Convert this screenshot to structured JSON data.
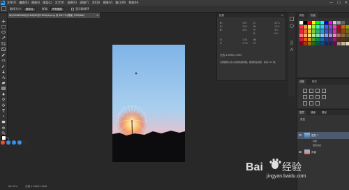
{
  "menubar": {
    "items": [
      "文件(F)",
      "编辑(E)",
      "图像(I)",
      "图层(L)",
      "文字(Y)",
      "选择(S)",
      "滤镜(T)",
      "3D(D)",
      "视图(V)",
      "窗口(W)",
      "帮助(H)"
    ],
    "window_controls": [
      "—",
      "□",
      "✕"
    ]
  },
  "options": {
    "sample_label": "取样大小:",
    "sample_value": "取样点",
    "sample_all_label": "样本:",
    "sample_all_value": "所有图层",
    "show_ring_label": "显示取样环"
  },
  "document": {
    "tab_title": "WJ-ADSKGN8(CJ1D8)0E@F1K6LJA.png @ 66.7%(背景, RGB/8#)",
    "close": "×"
  },
  "info": {
    "title": "信息",
    "r_label": "R:",
    "g_label": "G:",
    "b_label": "B:",
    "c_label": "C:",
    "m_label": "M:",
    "y_label": "Y:",
    "k_label": "K:",
    "x_label": "X:",
    "y2_label": "Y:",
    "w_label": "W:",
    "h_label": "H:",
    "r_val": "159",
    "g_val": "196",
    "b_val": "230",
    "c_val": "42%",
    "m_val": "14%",
    "y_val": "4%",
    "k_val": "0%",
    "x_val": "3.81",
    "y2_val": "4.50",
    "doc_line": "文档:1.69M/1.69M",
    "hint_line": "点按图像以置入新颜色取样器。要用附加选项，使用 Ctrl 键。"
  },
  "swatches": {
    "tabs": [
      "颜色",
      "色板"
    ],
    "colors": [
      "#ffffff",
      "#000000",
      "#ff0000",
      "#ffff00",
      "#00ff00",
      "#00ffff",
      "#0000ff",
      "#ff00ff",
      "#cccccc",
      "#999999",
      "#666666",
      "#333333",
      "#ff3333",
      "#ff9933",
      "#ffff66",
      "#99ff33",
      "#33ff99",
      "#33ccff",
      "#3366ff",
      "#9933ff",
      "#ff33cc",
      "#cc0000",
      "#cc6600",
      "#999900",
      "#ee2244",
      "#f06a2c",
      "#f5c52a",
      "#7ccf3a",
      "#2fb36e",
      "#2a9ad6",
      "#2e5cc8",
      "#6a3cc8",
      "#c03c9c",
      "#8a1a1a",
      "#8a4a14",
      "#6a6a14",
      "#f47a7a",
      "#f8b070",
      "#fae28a",
      "#b8e88a",
      "#86dbb0",
      "#88c8f0",
      "#8aa0ee",
      "#b08ae8",
      "#e88ac8",
      "#b06a4a",
      "#8a6a4a",
      "#6a5a3a",
      "#c81e3c",
      "#e85a10",
      "#e0a010",
      "#4aa02a",
      "#108a50",
      "#1070b0",
      "#1040a0",
      "#4a2090",
      "#a01870",
      "#5a2a1a",
      "#4a3a1a",
      "#3a3a1a",
      "#7a0a1a",
      "#a03a0a",
      "#a07010",
      "#2a6a1a",
      "#0a5a3a",
      "#0a4a7a",
      "#0a2a6a",
      "#2a1a5a",
      "#6a0a4a",
      "#a88a6a",
      "#c8b89a",
      "#e8d8c0"
    ]
  },
  "adjustments": {
    "tabs": [
      "调整",
      "样式"
    ]
  },
  "layers": {
    "tabs": [
      "图层",
      "通道",
      "路径"
    ],
    "kind_label": "类型",
    "rows": [
      {
        "name": "图层 1",
        "selected": true
      },
      {
        "name": "背景",
        "selected": false
      }
    ],
    "effects": [
      "效果",
      "颜色叠加"
    ]
  },
  "status": {
    "zoom": "66.67%",
    "doc": "文档:1.69M/1.69M"
  },
  "watermark": {
    "brand": "Bai",
    "brand_rest": "经验",
    "url": "jingyan.baidu.com"
  }
}
